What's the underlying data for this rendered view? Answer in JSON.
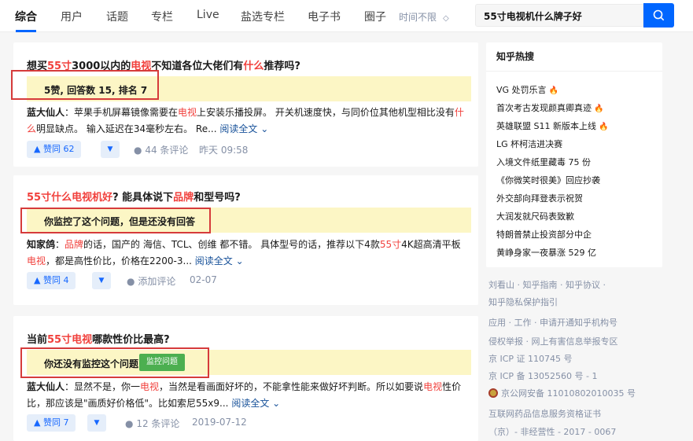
{
  "tabs": [
    {
      "label": "综合",
      "active": true
    },
    {
      "label": "用户"
    },
    {
      "label": "话题"
    },
    {
      "label": "专栏"
    },
    {
      "label": "Live"
    },
    {
      "label": "盐选专栏"
    },
    {
      "label": "电子书"
    },
    {
      "label": "圈子"
    }
  ],
  "time_filter": {
    "label": "时间不限"
  },
  "search": {
    "query": "55寸电视机什么牌子好"
  },
  "results": [
    {
      "title": [
        "想买",
        "55寸",
        "3000以内的",
        "电视",
        "不知道各位大佬们有",
        "什么",
        "推荐吗?"
      ],
      "notice": "5赞, 回答数 15, 排名 7",
      "author": "蓝大仙人",
      "excerpt": [
        "：苹果手机屏幕镜像需要在",
        "电视",
        "上安装乐播投屏。 开关机速度快，与同价位其他机型相比没有",
        "什",
        "么",
        "明显缺点。 输入延迟在34毫秒左右。 Re..."
      ],
      "read_more": "阅读全文",
      "vote": "赞同 62",
      "comments": "44 条评论",
      "time": "昨天 09:58"
    },
    {
      "title": [
        "55寸什么电视机好",
        "? 能具体说下",
        "品牌",
        "和型号吗?"
      ],
      "notice": "你监控了这个问题，但是还没有回答",
      "author": "知家鸽",
      "excerpt": [
        "：",
        "品牌",
        "的话，国产的 海信、TCL、创维 都不错。 具体型号的话，推荐以下4款",
        "55寸",
        "4K超高清平板",
        "电视",
        "，都是高性价比，价格在2200-3..."
      ],
      "read_more": "阅读全文",
      "vote": "赞同 4",
      "comments": "添加评论",
      "time": "02-07"
    },
    {
      "title": [
        "当前",
        "55寸电视",
        "哪款性价比最高?"
      ],
      "notice": "你还没有监控这个问题",
      "monitor_button": "监控问题",
      "author": "蓝大仙人",
      "excerpt": [
        "：显然不是，你一",
        "电视",
        "，当然是看画面好坏的，不能拿性能来做好坏判断。所以如要说",
        "电视",
        "性价",
        "比，那应该是\"画质好价格低\"。比如索尼55x9..."
      ],
      "read_more": "阅读全文",
      "vote": "赞同 7",
      "comments": "12 条评论",
      "time": "2019-07-12"
    }
  ],
  "hot_search": {
    "title": "知乎热搜",
    "items": [
      {
        "text": "VG 处罚乐言",
        "hot": true
      },
      {
        "text": "首次考古发现颜真卿真迹",
        "hot": true
      },
      {
        "text": "英雄联盟 S11 新版本上线",
        "hot": true
      },
      {
        "text": "LG 杯柯洁进决赛",
        "hot": false
      },
      {
        "text": "入境文件纸里藏毒 75 份",
        "hot": false
      },
      {
        "text": "《你微笑时很美》回应抄袭",
        "hot": false
      },
      {
        "text": "外交部向拜登表示祝贺",
        "hot": false
      },
      {
        "text": "大润发就尺码表致歉",
        "hot": false
      },
      {
        "text": "特朗普禁止投资部分中企",
        "hot": false
      },
      {
        "text": "黄峥身家一夜暴涨 529 亿",
        "hot": false
      }
    ]
  },
  "footer": [
    "刘看山 · 知乎指南 · 知乎协议 ·",
    "知乎隐私保护指引",
    "应用 · 工作 · 申请开通知乎机构号",
    "侵权举报 · 网上有害信息举报专区",
    "京 ICP 证 110745 号",
    "京 ICP 备 13052560 号 - 1",
    "京公网安备 11010802010035 号",
    "互联网药品信息服务资格证书",
    "（京）- 非经营性 - 2017 - 0067"
  ],
  "colors": {
    "accent": "#0066ff",
    "highlight": "#f1403c",
    "notice_bg": "#fcf6c5",
    "annotation_box": "#d63b3b",
    "monitor_button": "#4caf50"
  }
}
